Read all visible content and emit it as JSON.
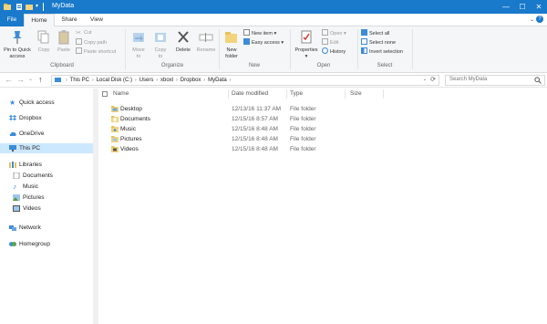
{
  "window": {
    "title": "MyData",
    "controls": {
      "minimize": "—",
      "maximize": "☐",
      "close": "✕"
    }
  },
  "ribbon_tabs": {
    "file": "File",
    "home": "Home",
    "share": "Share",
    "view": "View"
  },
  "help": "?",
  "clipboard": {
    "label": "Clipboard",
    "pin": [
      "Pin to Quick",
      "access"
    ],
    "copy": "Copy",
    "paste": "Paste",
    "cut": "Cut",
    "copy_path": "Copy path",
    "paste_shortcut": "Paste shortcut"
  },
  "organize": {
    "label": "Organize",
    "move_to": [
      "Move",
      "to"
    ],
    "copy_to": [
      "Copy",
      "to"
    ],
    "delete": "Delete",
    "rename": "Rename"
  },
  "new_group": {
    "label": "New",
    "new_folder": [
      "New",
      "folder"
    ],
    "new_item": "New item",
    "easy_access": "Easy access"
  },
  "open_group": {
    "label": "Open",
    "properties": "Properties",
    "open": "Open",
    "edit": "Edit",
    "history": "History"
  },
  "select_group": {
    "label": "Select",
    "select_all": "Select all",
    "select_none": "Select none",
    "invert": "Invert selection"
  },
  "address": {
    "crumbs": [
      "This PC",
      "Local Disk (C:)",
      "Users",
      "xboxl",
      "Dropbox",
      "MyData"
    ],
    "search_placeholder": "Search MyData"
  },
  "nav": {
    "items": [
      {
        "label": "Quick access",
        "indent": 0,
        "icon": "star-icon"
      },
      {
        "label": "Dropbox",
        "indent": 0,
        "icon": "dropbox-icon"
      },
      {
        "label": "OneDrive",
        "indent": 0,
        "icon": "cloud-icon"
      },
      {
        "label": "This PC",
        "indent": 0,
        "icon": "computer-icon",
        "selected": true
      },
      {
        "label": "Libraries",
        "indent": 0,
        "icon": "library-icon"
      },
      {
        "label": "Documents",
        "indent": 1,
        "icon": "document-icon"
      },
      {
        "label": "Music",
        "indent": 1,
        "icon": "music-icon"
      },
      {
        "label": "Pictures",
        "indent": 1,
        "icon": "picture-icon"
      },
      {
        "label": "Videos",
        "indent": 1,
        "icon": "video-icon"
      },
      {
        "label": "Network",
        "indent": 0,
        "icon": "network-icon"
      },
      {
        "label": "Homegroup",
        "indent": 0,
        "icon": "homegroup-icon"
      }
    ]
  },
  "columns": {
    "name": "Name",
    "date": "Date modified",
    "type": "Type",
    "size": "Size"
  },
  "files": [
    {
      "name": "Desktop",
      "date": "12/13/16 11:37 AM",
      "type": "File folder"
    },
    {
      "name": "Documents",
      "date": "12/15/16 8:57 AM",
      "type": "File folder"
    },
    {
      "name": "Music",
      "date": "12/15/16 8:48 AM",
      "type": "File folder"
    },
    {
      "name": "Pictures",
      "date": "12/15/16 8:48 AM",
      "type": "File folder"
    },
    {
      "name": "Videos",
      "date": "12/15/16 8:48 AM",
      "type": "File folder"
    }
  ],
  "colors": {
    "accent": "#1979ca",
    "selection": "#cce8ff",
    "folder": "#e8c35a",
    "ribbon_bg": "#f5f6f7"
  }
}
